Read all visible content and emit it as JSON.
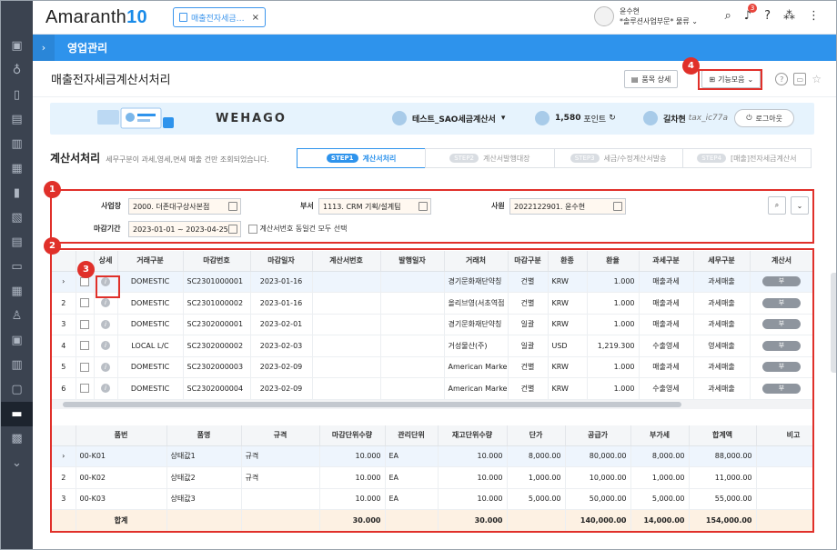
{
  "app": {
    "logo_text": "Amaranth",
    "logo_num": "10"
  },
  "tab": {
    "label": "매출전자세금…",
    "close": "×"
  },
  "user": {
    "name": "윤수현",
    "dept": "*솔루션사업부문* 물류"
  },
  "notifications": {
    "count": "3"
  },
  "module": {
    "title": "영업관리"
  },
  "page": {
    "title": "매출전자세금계산서처리",
    "item_detail": "품목 상세",
    "function_menu": "기능모음"
  },
  "wehago": {
    "logo": "WEHAGO",
    "company": "테스트_SAO세금계산서",
    "points_value": "1,580",
    "points_label": "포인트",
    "user_name": "길차현",
    "user_id": "tax_ic77a",
    "logout": "로그아웃"
  },
  "section": {
    "title": "계산서처리",
    "desc": "세무구분이 과세,영세,면세 매출 건만 조회되었습니다."
  },
  "steps": [
    {
      "num": "STEP1",
      "label": "계산서처리"
    },
    {
      "num": "STEP2",
      "label": "계산서발행대장"
    },
    {
      "num": "STEP3",
      "label": "세금/수정계산서발송"
    },
    {
      "num": "STEP4",
      "label": "[매출]전자세금계산서"
    }
  ],
  "filters": {
    "site_label": "사업장",
    "site_value": "2000. 더존대구상사본점",
    "dept_label": "부서",
    "dept_value": "1113. CRM 기획/설계팀",
    "emp_label": "사원",
    "emp_value": "2022122901. 윤수현",
    "period_label": "마감기간",
    "period_value": "2023-01-01 ~ 2023-04-25",
    "same_select_label": "계산서번호 동일건 모두 선택"
  },
  "markers": {
    "m1": "1",
    "m2": "2",
    "m3": "3",
    "m4": "4"
  },
  "grid1": {
    "headers": [
      "상세",
      "거래구분",
      "마감번호",
      "마감일자",
      "계산서번호",
      "발행일자",
      "거래처",
      "마감구분",
      "환종",
      "환율",
      "과세구분",
      "세무구분",
      "계산서"
    ],
    "rows": [
      {
        "no": "1",
        "type": "DOMESTIC",
        "close_no": "SC2301000001",
        "close_date": "2023-01-16",
        "partner": "경기문화재단약칭",
        "close_kind": "건별",
        "currency": "KRW",
        "rate": "1.000",
        "tax_kind": "매출과세",
        "tax_class": "과세매출",
        "bill": "부"
      },
      {
        "no": "2",
        "type": "DOMESTIC",
        "close_no": "SC2301000002",
        "close_date": "2023-01-16",
        "partner": "올리브영(서초역점",
        "close_kind": "건별",
        "currency": "KRW",
        "rate": "1.000",
        "tax_kind": "매출과세",
        "tax_class": "과세매출",
        "bill": "부"
      },
      {
        "no": "3",
        "type": "DOMESTIC",
        "close_no": "SC2302000001",
        "close_date": "2023-02-01",
        "partner": "경기문화재단약칭",
        "close_kind": "일괄",
        "currency": "KRW",
        "rate": "1.000",
        "tax_kind": "매출과세",
        "tax_class": "과세매출",
        "bill": "부"
      },
      {
        "no": "4",
        "type": "LOCAL L/C",
        "close_no": "SC2302000002",
        "close_date": "2023-02-03",
        "partner": "거성물산(주)",
        "close_kind": "일괄",
        "currency": "USD",
        "rate": "1,219.300",
        "tax_kind": "수출영세",
        "tax_class": "영세매출",
        "bill": "부"
      },
      {
        "no": "5",
        "type": "DOMESTIC",
        "close_no": "SC2302000003",
        "close_date": "2023-02-09",
        "partner": "American Marke",
        "close_kind": "건별",
        "currency": "KRW",
        "rate": "1.000",
        "tax_kind": "매출과세",
        "tax_class": "과세매출",
        "bill": "부"
      },
      {
        "no": "6",
        "type": "DOMESTIC",
        "close_no": "SC2302000004",
        "close_date": "2023-02-09",
        "partner": "American Marke",
        "close_kind": "건별",
        "currency": "KRW",
        "rate": "1.000",
        "tax_kind": "수출영세",
        "tax_class": "과세매출",
        "bill": "부"
      }
    ]
  },
  "grid2": {
    "headers": [
      "품번",
      "품명",
      "규격",
      "마감단위수량",
      "관리단위",
      "재고단위수량",
      "단가",
      "공급가",
      "부가세",
      "합계액",
      "비고"
    ],
    "rows": [
      {
        "no": "1",
        "code": "00-K01",
        "name": "상태값1",
        "spec": "규격",
        "qty": "10.000",
        "unit": "EA",
        "stock_qty": "10.000",
        "price": "8,000.00",
        "supply": "80,000.00",
        "vat": "8,000.00",
        "total": "88,000.00",
        "note": ""
      },
      {
        "no": "2",
        "code": "00-K02",
        "name": "상태값2",
        "spec": "규격",
        "qty": "10.000",
        "unit": "EA",
        "stock_qty": "10.000",
        "price": "1,000.00",
        "supply": "10,000.00",
        "vat": "1,000.00",
        "total": "11,000.00",
        "note": ""
      },
      {
        "no": "3",
        "code": "00-K03",
        "name": "상태값3",
        "spec": "",
        "qty": "10.000",
        "unit": "EA",
        "stock_qty": "10.000",
        "price": "5,000.00",
        "supply": "50,000.00",
        "vat": "5,000.00",
        "total": "55,000.00",
        "note": ""
      }
    ],
    "sum": {
      "label": "합계",
      "qty": "30.000",
      "stock_qty": "30.000",
      "supply": "140,000.00",
      "vat": "14,000.00",
      "total": "154,000.00"
    }
  },
  "colors": {
    "accent": "#2e93ec",
    "marker": "#e0302a",
    "sidebar": "#3b4350"
  }
}
